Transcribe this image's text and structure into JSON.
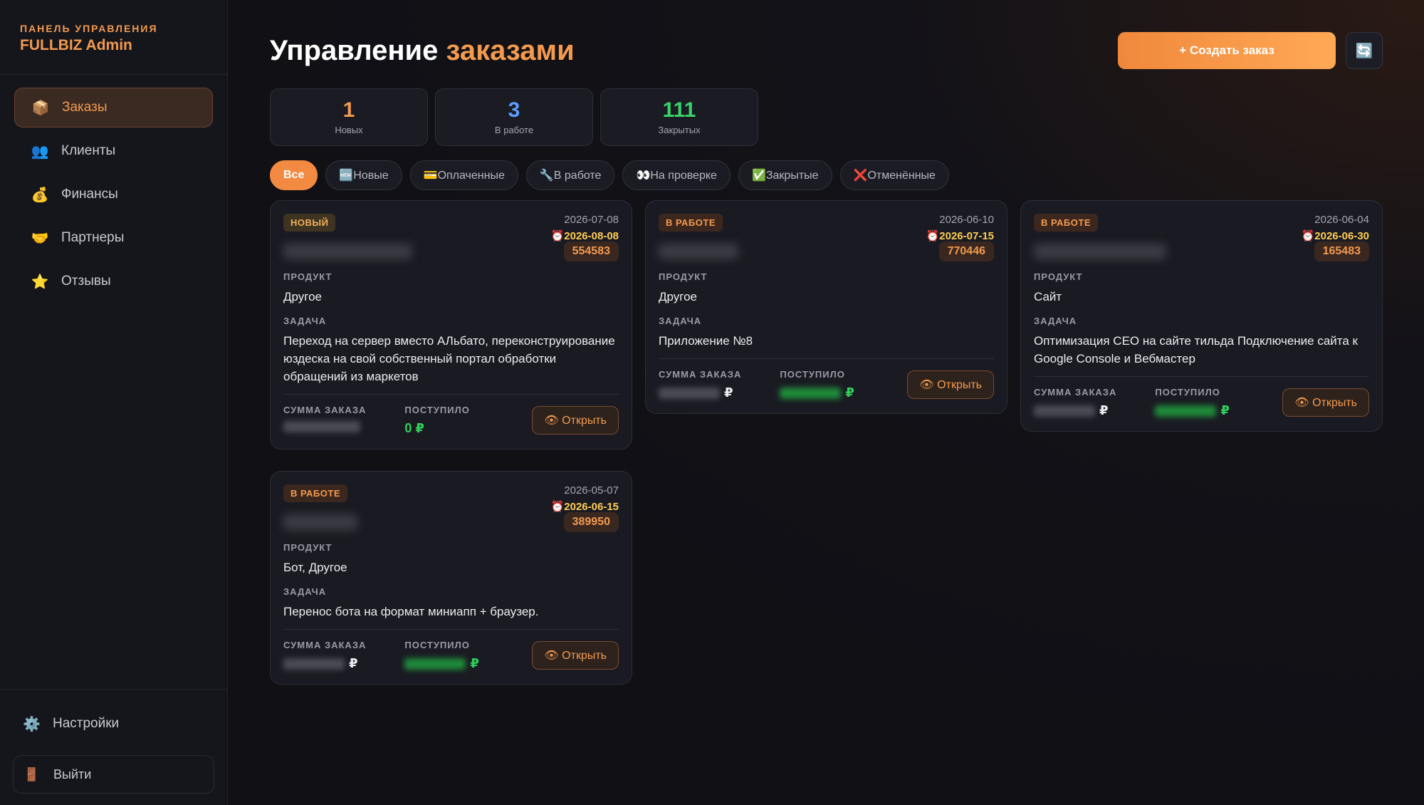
{
  "sidebar": {
    "subtitle": "ПАНЕЛЬ УПРАВЛЕНИЯ",
    "title": "FULLBIZ Admin",
    "items": [
      {
        "icon": "📦",
        "label": "Заказы"
      },
      {
        "icon": "👥",
        "label": "Клиенты"
      },
      {
        "icon": "💰",
        "label": "Финансы"
      },
      {
        "icon": "🤝",
        "label": "Партнеры"
      },
      {
        "icon": "⭐",
        "label": "Отзывы"
      }
    ],
    "settings": {
      "icon": "⚙️",
      "label": "Настройки"
    },
    "logout": {
      "icon": "🚪",
      "label": "Выйти"
    }
  },
  "header": {
    "title_part1": "Управление",
    "title_part2": "заказами",
    "create_button": "+ Создать заказ",
    "refresh_icon": "🔄"
  },
  "stats": [
    {
      "value": "1",
      "label": "Новых",
      "color": "#f39a4e"
    },
    {
      "value": "3",
      "label": "В работе",
      "color": "#5b9dff"
    },
    {
      "value": "111",
      "label": "Закрытых",
      "color": "#38d46a"
    }
  ],
  "filters": [
    {
      "label": "Все",
      "active": true
    },
    {
      "label": "🆕Новые"
    },
    {
      "label": "💳Оплаченные"
    },
    {
      "label": "🔧В работе"
    },
    {
      "label": "👀На проверке"
    },
    {
      "label": "✅Закрытые"
    },
    {
      "label": "❌Отменённые"
    }
  ],
  "labels": {
    "product": "ПРОДУКТ",
    "task": "ЗАДАЧА",
    "amount": "СУММА ЗАКАЗА",
    "received": "ПОСТУПИЛО",
    "open": "👁 Открыть",
    "rub": "₽"
  },
  "orders": [
    {
      "status": "НОВЫЙ",
      "created": "2026-07-08",
      "due": "⏰2026-08-08",
      "id": "554583",
      "product": "Другое",
      "task": "Переход на сервер вместо АЛьбато, переконструирование юздеска на свой собственный портал обработки обращений из маркетов",
      "received": "0 ₽"
    },
    {
      "status": "В РАБОТЕ",
      "created": "2026-06-10",
      "due": "⏰2026-07-15",
      "id": "770446",
      "product": "Другое",
      "task": "Приложение №8"
    },
    {
      "status": "В РАБОТЕ",
      "created": "2026-06-04",
      "due": "⏰2026-06-30",
      "id": "165483",
      "product": "Сайт",
      "task": "Оптимизация СЕО на сайте тильда Подключение сайта к Google Console и Вебмастер"
    },
    {
      "status": "В РАБОТЕ",
      "created": "2026-05-07",
      "due": "⏰2026-06-15",
      "id": "389950",
      "product": "Бот, Другое",
      "task": "Перенос бота на формат миниапп + браузер."
    }
  ]
}
